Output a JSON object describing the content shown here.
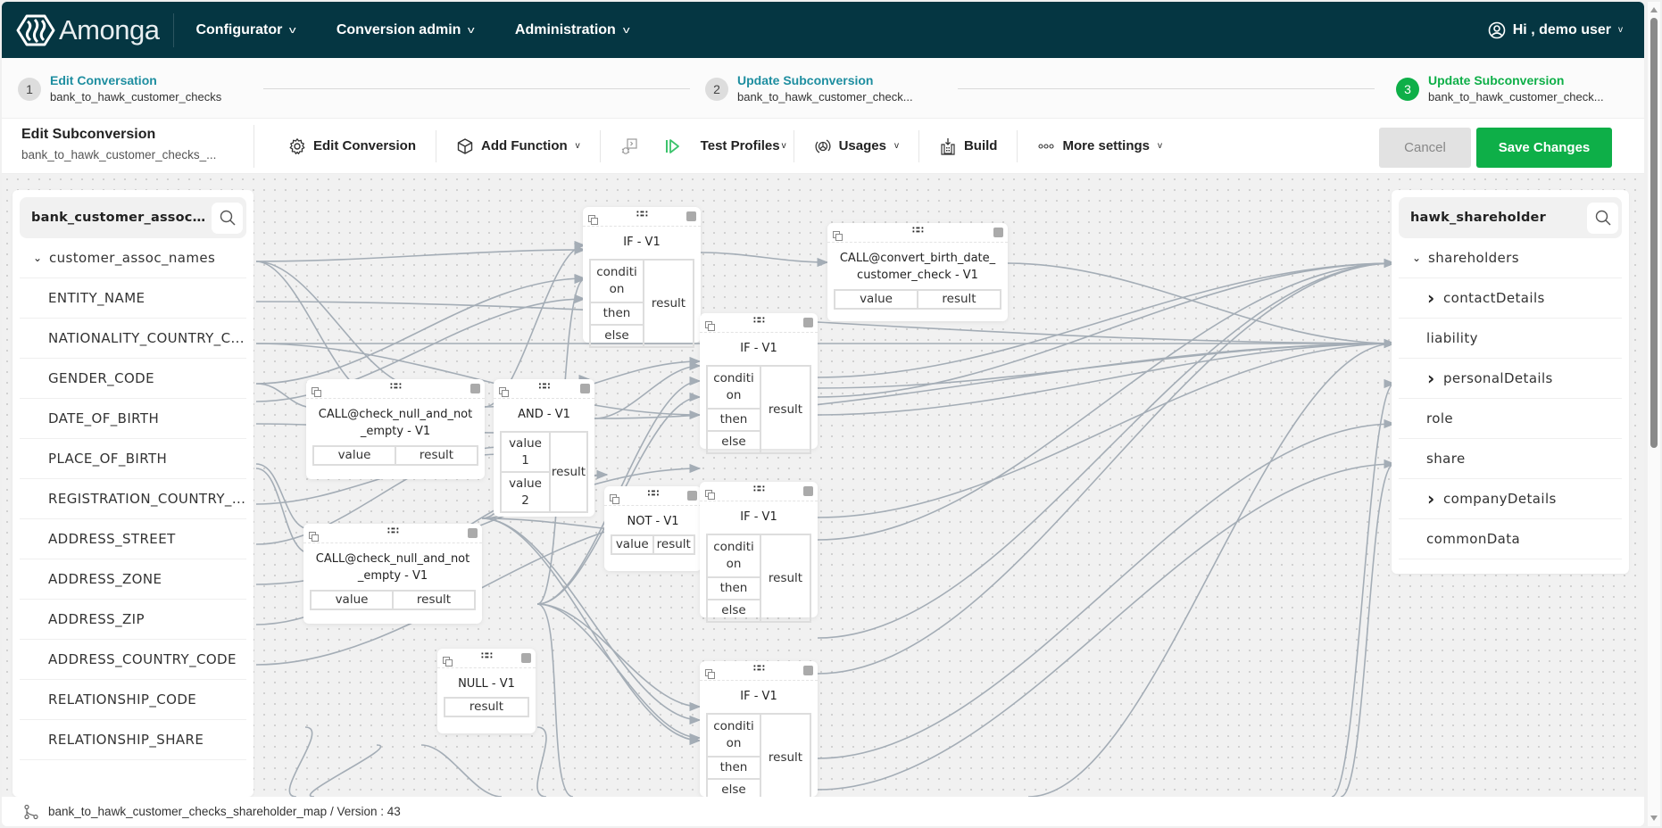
{
  "app": {
    "brand": "Amonga",
    "nav": [
      {
        "label": "Configurator"
      },
      {
        "label": "Conversion admin"
      },
      {
        "label": "Administration"
      }
    ],
    "user_greeting": "Hi , demo user"
  },
  "stepper": {
    "steps": [
      {
        "num": "1",
        "title": "Edit Conversation",
        "subtitle": "bank_to_hawk_customer_checks",
        "state": "done"
      },
      {
        "num": "2",
        "title": "Update Subconversion",
        "subtitle": "bank_to_hawk_customer_check...",
        "state": "done"
      },
      {
        "num": "3",
        "title": "Update Subconversion",
        "subtitle": "bank_to_hawk_customer_check...",
        "state": "active"
      }
    ]
  },
  "toolbar": {
    "title": "Edit Subconversion",
    "subtitle": "bank_to_hawk_customer_checks_...",
    "edit_conversion": "Edit Conversion",
    "add_function": "Add Function",
    "test_profiles": "Test Profiles",
    "usages": "Usages",
    "build": "Build",
    "more_settings": "More settings",
    "cancel": "Cancel",
    "save": "Save Changes"
  },
  "colors": {
    "nav_bg": "#053642",
    "accent_teal": "#1e8ea0",
    "accent_green": "#0eaf48",
    "wire": "#a4adb6"
  },
  "source_panel": {
    "search_value": "bank_customer_assoc_na...",
    "root": "customer_assoc_names",
    "fields": [
      "ENTITY_NAME",
      "NATIONALITY_COUNTRY_C...",
      "GENDER_CODE",
      "DATE_OF_BIRTH",
      "PLACE_OF_BIRTH",
      "REGISTRATION_COUNTRY_...",
      "ADDRESS_STREET",
      "ADDRESS_ZONE",
      "ADDRESS_ZIP",
      "ADDRESS_COUNTRY_CODE",
      "RELATIONSHIP_CODE",
      "RELATIONSHIP_SHARE"
    ]
  },
  "target_panel": {
    "search_value": "hawk_shareholder",
    "root": "shareholders",
    "fields": [
      {
        "label": "contactDetails",
        "expandable": true
      },
      {
        "label": "liability",
        "expandable": false
      },
      {
        "label": "personalDetails",
        "expandable": true
      },
      {
        "label": "role",
        "expandable": false
      },
      {
        "label": "share",
        "expandable": false
      },
      {
        "label": "companyDetails",
        "expandable": true
      },
      {
        "label": "commonData",
        "expandable": false
      }
    ]
  },
  "nodes": {
    "if1": {
      "title": "IF - V1",
      "inputs": [
        "conditi on",
        "then",
        "else"
      ],
      "output": "result"
    },
    "convert": {
      "title": "CALL@convert_birth_date_ customer_check - V1",
      "input": "value",
      "output": "result"
    },
    "if2": {
      "title": "IF - V1",
      "inputs": [
        "conditi on",
        "then",
        "else"
      ],
      "output": "result"
    },
    "check1": {
      "title": "CALL@check_null_and_not _empty - V1",
      "input": "value",
      "output": "result"
    },
    "and": {
      "title": "AND - V1",
      "inputs": [
        "value 1",
        "value 2"
      ],
      "output": "result"
    },
    "check2": {
      "title": "CALL@check_null_and_not _empty - V1",
      "input": "value",
      "output": "result"
    },
    "not": {
      "title": "NOT - V1",
      "input": "value",
      "output": "result"
    },
    "if3": {
      "title": "IF - V1",
      "inputs": [
        "conditi on",
        "then",
        "else"
      ],
      "output": "result"
    },
    "null": {
      "title": "NULL - V1",
      "output": "result"
    },
    "if4": {
      "title": "IF - V1",
      "inputs": [
        "conditi on",
        "then",
        "else"
      ],
      "output": "result"
    }
  },
  "footer": {
    "text": "bank_to_hawk_customer_checks_shareholder_map / Version : 43"
  }
}
